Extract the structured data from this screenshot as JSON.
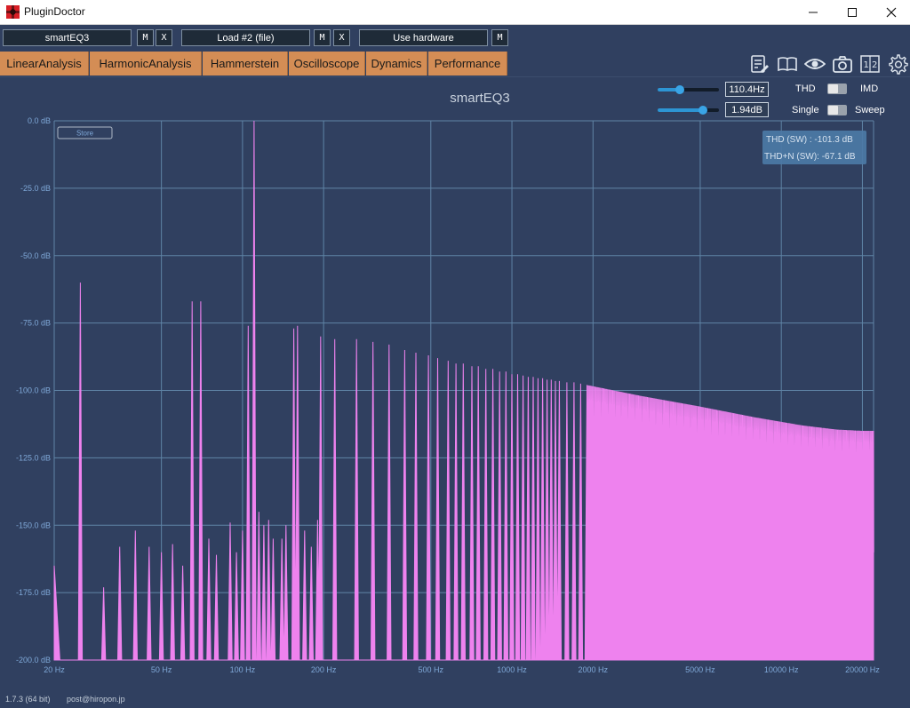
{
  "window": {
    "title": "PluginDoctor",
    "controls": [
      "minimize",
      "maximize",
      "close"
    ]
  },
  "slots": [
    {
      "label": "smartEQ3",
      "buttons": [
        "M",
        "X"
      ]
    },
    {
      "label": "Load #2 (file)",
      "buttons": [
        "M",
        "X"
      ]
    },
    {
      "label": "Use hardware",
      "buttons": [
        "M"
      ]
    }
  ],
  "tabs": [
    {
      "label": "LinearAnalysis",
      "active": false
    },
    {
      "label": "HarmonicAnalysis",
      "active": true
    },
    {
      "label": "Hammerstein",
      "active": false
    },
    {
      "label": "Oscilloscope",
      "active": false
    },
    {
      "label": "Dynamics",
      "active": false
    },
    {
      "label": "Performance",
      "active": false
    }
  ],
  "toolbar_icons": [
    "notes-icon",
    "book-icon",
    "eye-icon",
    "camera-icon",
    "split-1-2-icon",
    "gear-icon"
  ],
  "controls": {
    "frequency": {
      "value": "110.4Hz",
      "level": 0.36
    },
    "amplitude": {
      "value": "1.94dB",
      "level": 0.74
    },
    "mode_left": "THD",
    "mode_right": "IMD",
    "sweep_left": "Single",
    "sweep_right": "Sweep"
  },
  "store_label": "Store",
  "readout": {
    "thd": "THD (SW) : -101.3 dB",
    "thdn": "THD+N (SW): -67.1 dB"
  },
  "footer": {
    "version": "1.7.3 (64 bit)",
    "email": "post@hiropon.jp"
  },
  "colors": {
    "background": "#304060",
    "plot": "#ee82ee",
    "accent": "#d48d55",
    "grid": "#5f84a6"
  },
  "chart_data": {
    "type": "line",
    "title": "smartEQ3",
    "x_scale": "log",
    "xlim": [
      20,
      22000
    ],
    "ylim": [
      -200,
      0
    ],
    "x_ticks": [
      20,
      50,
      100,
      200,
      500,
      1000,
      2000,
      5000,
      10000,
      20000
    ],
    "x_tick_labels": [
      "20 Hz",
      "50 Hz",
      "100 Hz",
      "200 Hz",
      "500 Hz",
      "1000 Hz",
      "2000 Hz",
      "5000 Hz",
      "10000 Hz",
      "20000 Hz"
    ],
    "y_ticks": [
      0,
      -25,
      -50,
      -75,
      -100,
      -125,
      -150,
      -175,
      -200
    ],
    "y_tick_labels": [
      "0.0 dB",
      "-25.0 dB",
      "-50.0 dB",
      "-75.0 dB",
      "-100.0 dB",
      "-125.0 dB",
      "-150.0 dB",
      "-175.0 dB",
      "-200.0 dB"
    ],
    "grid": true,
    "series": [
      {
        "peaks": [
          [
            25,
            -60
          ],
          [
            30.5,
            -173
          ],
          [
            35,
            -158
          ],
          [
            40,
            -152
          ],
          [
            45,
            -158
          ],
          [
            50,
            -160
          ],
          [
            55,
            -157
          ],
          [
            60,
            -165
          ],
          [
            65,
            -67
          ],
          [
            70,
            -67
          ],
          [
            75,
            -155
          ],
          [
            80,
            -161
          ],
          [
            90,
            -149
          ],
          [
            95,
            -160
          ],
          [
            100,
            -152
          ],
          [
            105,
            -76
          ],
          [
            110.4,
            0
          ],
          [
            115,
            -145
          ],
          [
            120,
            -150
          ],
          [
            125,
            -148
          ],
          [
            130,
            -155
          ],
          [
            140,
            -155
          ],
          [
            145,
            -150
          ],
          [
            155,
            -77
          ],
          [
            160,
            -76
          ],
          [
            170,
            -152
          ],
          [
            180,
            -158
          ],
          [
            190,
            -148
          ],
          [
            195,
            -80
          ],
          [
            220,
            -81
          ],
          [
            265,
            -81
          ],
          [
            305,
            -82
          ],
          [
            350,
            -83
          ],
          [
            400,
            -85
          ],
          [
            440,
            -86
          ],
          [
            490,
            -87
          ],
          [
            530,
            -88
          ],
          [
            580,
            -89
          ],
          [
            620,
            -90
          ],
          [
            660,
            -90
          ],
          [
            710,
            -91
          ],
          [
            750,
            -91
          ],
          [
            800,
            -92
          ],
          [
            850,
            -92
          ],
          [
            900,
            -93
          ],
          [
            950,
            -93
          ],
          [
            1000,
            -94
          ],
          [
            1050,
            -94
          ],
          [
            1100,
            -94.5
          ],
          [
            1150,
            -95
          ],
          [
            1200,
            -95
          ],
          [
            1250,
            -95.5
          ],
          [
            1300,
            -95.5
          ],
          [
            1350,
            -96
          ],
          [
            1400,
            -96
          ],
          [
            1450,
            -96.5
          ],
          [
            1500,
            -96.5
          ],
          [
            1600,
            -97
          ],
          [
            1700,
            -97
          ],
          [
            1800,
            -97.5
          ],
          [
            1900,
            -98
          ]
        ],
        "envelope": [
          [
            1900,
            -98
          ],
          [
            3000,
            -102
          ],
          [
            5000,
            -106
          ],
          [
            8000,
            -110
          ],
          [
            12000,
            -113
          ],
          [
            16000,
            -114.5
          ],
          [
            20000,
            -115
          ],
          [
            22000,
            -115
          ]
        ]
      }
    ]
  }
}
